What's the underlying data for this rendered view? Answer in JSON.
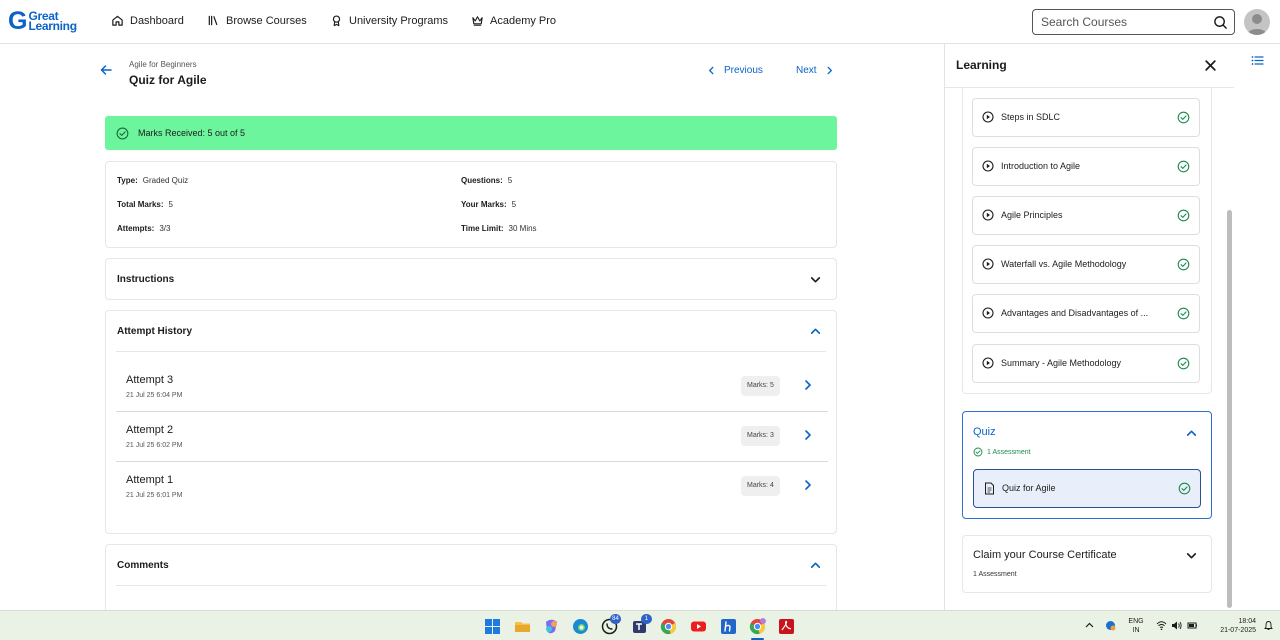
{
  "nav": {
    "logo_great": "Great",
    "logo_learning": "Learning",
    "items": [
      {
        "label": "Dashboard",
        "icon": "home-icon"
      },
      {
        "label": "Browse Courses",
        "icon": "library-icon"
      },
      {
        "label": "University Programs",
        "icon": "award-icon"
      },
      {
        "label": "Academy Pro",
        "icon": "crown-icon"
      }
    ],
    "search_placeholder": "Search Courses"
  },
  "header": {
    "breadcrumb": "Agile for Beginners",
    "title": "Quiz for Agile",
    "previous_label": "Previous",
    "next_label": "Next"
  },
  "result": {
    "banner_text": "Marks Received: 5 out of 5",
    "info": {
      "type_label": "Type:",
      "type_value": "Graded Quiz",
      "questions_label": "Questions:",
      "questions_value": "5",
      "total_label": "Total Marks:",
      "total_value": "5",
      "your_label": "Your Marks:",
      "your_value": "5",
      "attempts_label": "Attempts:",
      "attempts_value": "3/3",
      "time_label": "Time Limit:",
      "time_value": "30 Mins"
    }
  },
  "sections": {
    "instructions": "Instructions",
    "attempt_history": "Attempt History",
    "comments": "Comments"
  },
  "attempts": [
    {
      "title": "Attempt 3",
      "date": "21 Jul 25 6:04 PM",
      "marks": "Marks: 5"
    },
    {
      "title": "Attempt 2",
      "date": "21 Jul 25 6:02 PM",
      "marks": "Marks: 3"
    },
    {
      "title": "Attempt 1",
      "date": "21 Jul 25 6:01 PM",
      "marks": "Marks: 4"
    }
  ],
  "sidebar": {
    "title": "Learning",
    "lessons": [
      {
        "label": "Steps in SDLC"
      },
      {
        "label": "Introduction to Agile"
      },
      {
        "label": "Agile Principles"
      },
      {
        "label": "Waterfall vs. Agile Methodology"
      },
      {
        "label": "Advantages and Disadvantages of ..."
      },
      {
        "label": "Summary - Agile Methodology"
      }
    ],
    "quiz": {
      "title": "Quiz",
      "count": "1 Assessment",
      "item": "Quiz for Agile"
    },
    "certificate": {
      "title": "Claim your Course Certificate",
      "count": "1 Assessment"
    }
  },
  "taskbar": {
    "whatsapp_badge": "84",
    "teams_badge": "1",
    "lang_top": "ENG",
    "lang_bottom": "IN",
    "time": "18:04",
    "date": "21-07-2025"
  },
  "colors": {
    "accent": "#0a63c9",
    "success_banner": "#6cf59d",
    "success_icon": "#1e8a4c",
    "active_item_bg": "#e9effa"
  }
}
